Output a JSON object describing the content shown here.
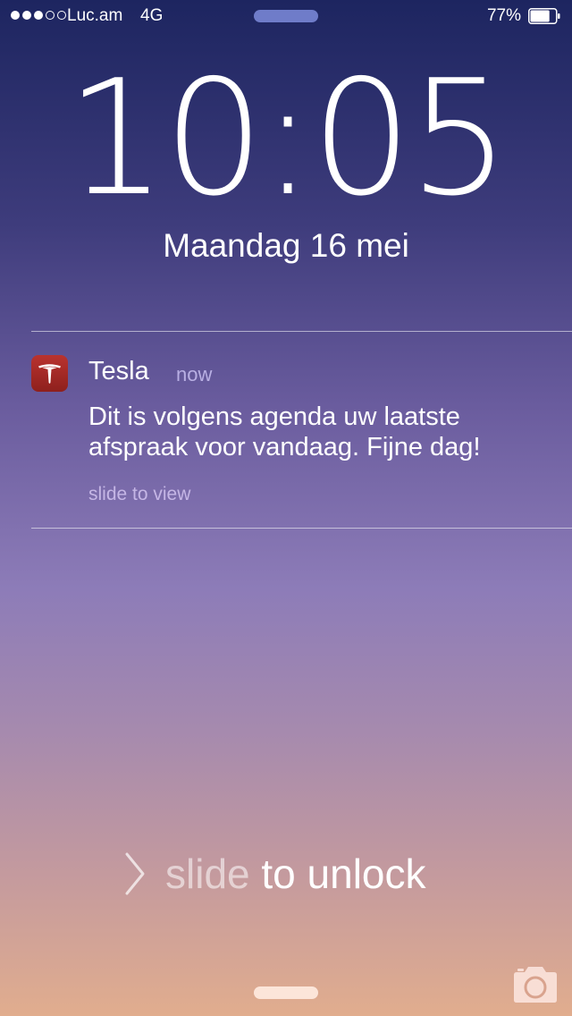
{
  "status_bar": {
    "signal_dots_filled": 3,
    "signal_dots_total": 5,
    "carrier": "Luc.am",
    "network": "4G",
    "battery_percent": "77%",
    "battery_level": 0.77
  },
  "lock_screen": {
    "time": "10:05",
    "date": "Maandag 16 mei"
  },
  "notification": {
    "app_name": "Tesla",
    "app_icon": "tesla-logo-icon",
    "time": "now",
    "body": "Dit is volgens agenda uw laatste afspraak voor vandaag. Fijne dag!",
    "action_hint": "slide to view"
  },
  "unlock": {
    "label_dim": "slide",
    "label_bright": " to unlock",
    "chevron_icon": "chevron-right-icon"
  },
  "bottom": {
    "camera_icon": "camera-icon"
  },
  "colors": {
    "gradient_top": "#1d2560",
    "gradient_bottom": "#e1ad8e",
    "tesla_red": "#b9332f"
  }
}
